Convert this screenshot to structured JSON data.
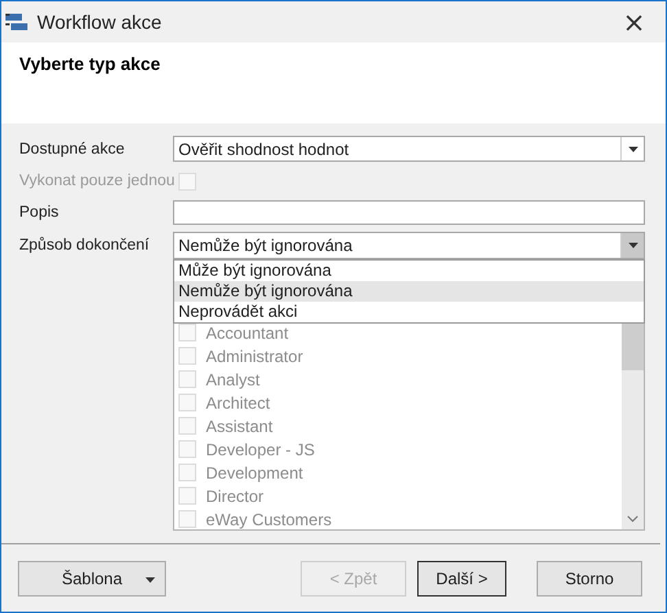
{
  "window": {
    "title": "Workflow akce",
    "close": "×"
  },
  "header": {
    "title": "Vyberte typ akce"
  },
  "form": {
    "fields": [
      {
        "kind": "combo",
        "label": "Dostupné akce",
        "value": "Ověřit shodnost hodnot",
        "open": false
      },
      {
        "kind": "checkbox",
        "label": "Vykonat pouze jednou",
        "checked": false,
        "disabled": true
      },
      {
        "kind": "text",
        "label": "Popis"
      },
      {
        "kind": "combo",
        "label": "Způsob dokončení",
        "value": "Nemůže být ignorována",
        "open": true,
        "options": [
          {
            "label": "Může být ignorována",
            "selected": false
          },
          {
            "label": "Nemůže být ignorována",
            "selected": true
          },
          {
            "label": "Neprovádět akci",
            "selected": false
          }
        ]
      }
    ]
  },
  "roles": [
    {
      "label": "Accountant",
      "checked": false,
      "disabled": true
    },
    {
      "label": "Administrator",
      "checked": false,
      "disabled": true
    },
    {
      "label": "Analyst",
      "checked": false,
      "disabled": true
    },
    {
      "label": "Architect",
      "checked": false,
      "disabled": true
    },
    {
      "label": "Assistant",
      "checked": false,
      "disabled": true
    },
    {
      "label": "Developer - JS",
      "checked": false,
      "disabled": true
    },
    {
      "label": "Development",
      "checked": false,
      "disabled": true
    },
    {
      "label": "Director",
      "checked": false,
      "disabled": true
    },
    {
      "label": "eWay Customers",
      "checked": false,
      "disabled": true
    }
  ],
  "buttons": [
    {
      "kind": "menu",
      "label": "Šablona",
      "disabled": false,
      "default": false
    },
    {
      "kind": "push",
      "label": "< Zpět",
      "disabled": true,
      "default": false
    },
    {
      "kind": "push",
      "label": "Další >",
      "disabled": false,
      "default": true
    },
    {
      "kind": "push",
      "label": "Storno",
      "disabled": false,
      "default": false
    }
  ]
}
